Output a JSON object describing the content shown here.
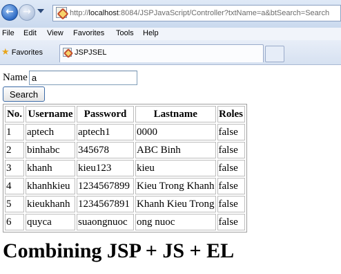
{
  "browser": {
    "address": {
      "prefix": "http://",
      "host": "localhost",
      "rest": ":8084/JSPJavaScript/Controller?txtName=a&btSearch=Search"
    },
    "menu": [
      "File",
      "Edit",
      "View",
      "Favorites",
      "Tools",
      "Help"
    ],
    "favorites_label": "Favorites",
    "tab_title": "JSPJSEL"
  },
  "form": {
    "name_label": "Name",
    "name_value": "a",
    "search_label": "Search"
  },
  "table": {
    "headers": [
      "No.",
      "Username",
      "Password",
      "Lastname",
      "Roles"
    ],
    "rows": [
      [
        "1",
        "aptech",
        "aptech1",
        "0000",
        "false"
      ],
      [
        "2",
        "binhabc",
        "345678",
        "ABC Binh",
        "false"
      ],
      [
        "3",
        "khanh",
        "kieu123",
        "kieu",
        "false"
      ],
      [
        "4",
        "khanhkieu",
        "1234567899",
        "Kieu Trong Khanh",
        "false"
      ],
      [
        "5",
        "kieukhanh",
        "1234567891",
        "Khanh Kieu Trong",
        "false"
      ],
      [
        "6",
        "quyca",
        "suaongnuoc",
        "ong nuoc",
        "false"
      ]
    ]
  },
  "heading": "Combining JSP + JS + EL"
}
